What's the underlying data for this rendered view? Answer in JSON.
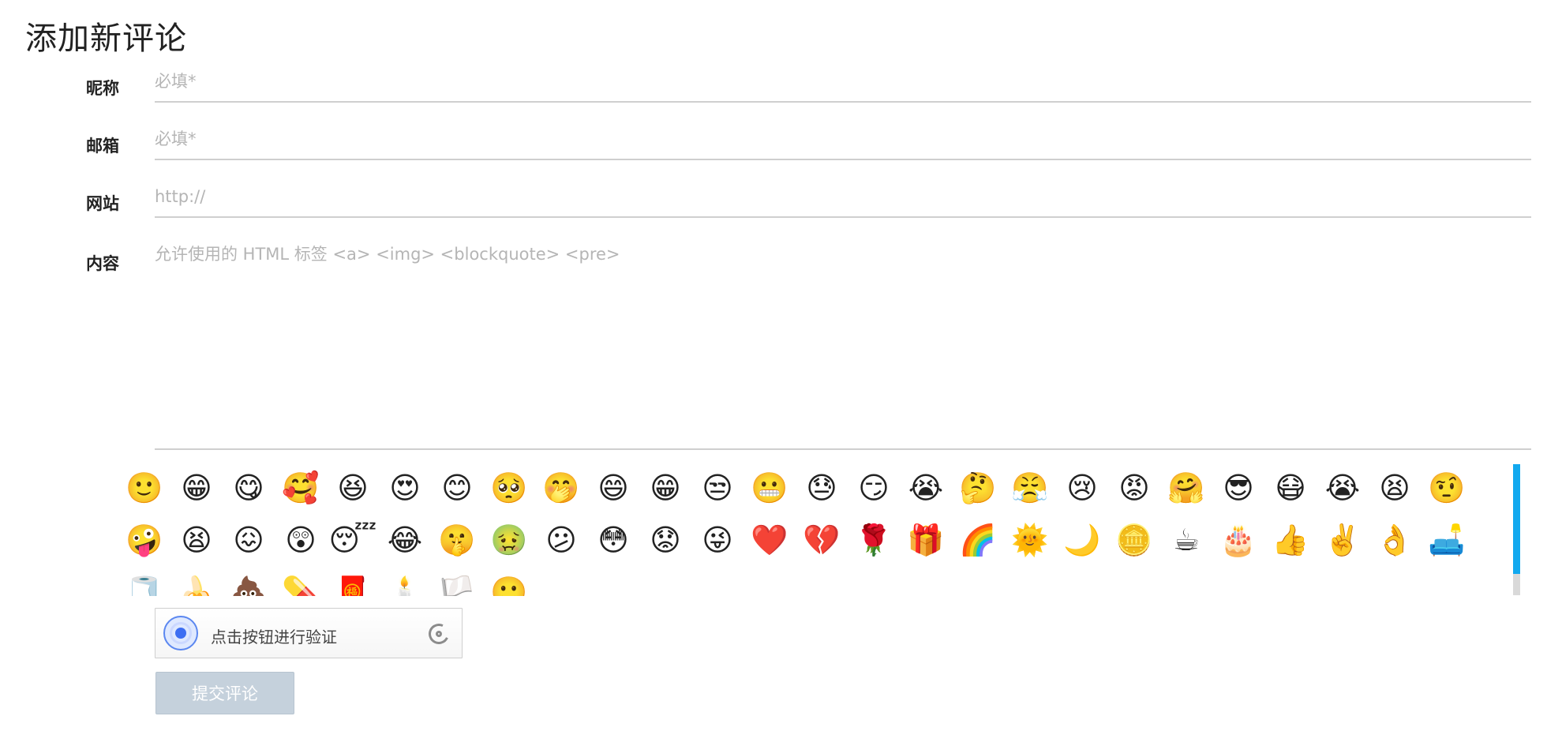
{
  "page": {
    "title": "添加新评论"
  },
  "form": {
    "fields": [
      {
        "label": "昵称",
        "placeholder": "必填*"
      },
      {
        "label": "邮箱",
        "placeholder": "必填*"
      },
      {
        "label": "网站",
        "placeholder": "http://"
      },
      {
        "label": "内容",
        "placeholder": "允许使用的 HTML 标签 <a> <img> <blockquote> <pre>"
      }
    ]
  },
  "emoji_panel": {
    "icons": [
      {
        "name": "smile-emoji-icon",
        "glyph": "🙂"
      },
      {
        "name": "grin-emoji-icon",
        "glyph": "😁"
      },
      {
        "name": "tongue-emoji-icon",
        "glyph": "😋"
      },
      {
        "name": "shy-emoji-icon",
        "glyph": "🥰"
      },
      {
        "name": "laugh-emoji-icon",
        "glyph": "😆"
      },
      {
        "name": "heart-eyes-emoji-icon",
        "glyph": "😍"
      },
      {
        "name": "blush-emoji-icon",
        "glyph": "😊"
      },
      {
        "name": "pleading-emoji-icon",
        "glyph": "🥺"
      },
      {
        "name": "giggle-emoji-icon",
        "glyph": "🤭"
      },
      {
        "name": "happy-emoji-icon",
        "glyph": "😄"
      },
      {
        "name": "beaming-emoji-icon",
        "glyph": "😁"
      },
      {
        "name": "unamused-emoji-icon",
        "glyph": "😒"
      },
      {
        "name": "grimace-emoji-icon",
        "glyph": "😬"
      },
      {
        "name": "sweat-emoji-icon",
        "glyph": "😓"
      },
      {
        "name": "smirk-emoji-icon",
        "glyph": "😏"
      },
      {
        "name": "crying-emoji-icon",
        "glyph": "😭"
      },
      {
        "name": "thinking-emoji-icon",
        "glyph": "🤔"
      },
      {
        "name": "annoyed-emoji-icon",
        "glyph": "😤"
      },
      {
        "name": "tears-emoji-icon",
        "glyph": "😢"
      },
      {
        "name": "angry-emoji-icon",
        "glyph": "😡"
      },
      {
        "name": "hug-emoji-icon",
        "glyph": "🤗"
      },
      {
        "name": "sunglasses-emoji-icon",
        "glyph": "😎"
      },
      {
        "name": "mask-emoji-icon",
        "glyph": "😷"
      },
      {
        "name": "sob-emoji-icon",
        "glyph": "😭"
      },
      {
        "name": "shout-emoji-icon",
        "glyph": "😫"
      },
      {
        "name": "confused-emoji-icon",
        "glyph": "🤨"
      },
      {
        "name": "dizzy-emoji-icon",
        "glyph": "🤪"
      },
      {
        "name": "yawn-emoji-icon",
        "glyph": "😫"
      },
      {
        "name": "pout-emoji-icon",
        "glyph": "😖"
      },
      {
        "name": "surprised-emoji-icon",
        "glyph": "😲"
      },
      {
        "name": "sleepy-emoji-icon",
        "glyph": "😴"
      },
      {
        "name": "joy-emoji-icon",
        "glyph": "😂"
      },
      {
        "name": "shush-emoji-icon",
        "glyph": "🤫"
      },
      {
        "name": "sick-emoji-icon",
        "glyph": "🤢"
      },
      {
        "name": "meh-emoji-icon",
        "glyph": "😕"
      },
      {
        "name": "flushed-emoji-icon",
        "glyph": "😳"
      },
      {
        "name": "worried-emoji-icon",
        "glyph": "😟"
      },
      {
        "name": "wink-emoji-icon",
        "glyph": "😜"
      },
      {
        "name": "heart-icon",
        "glyph": "❤️"
      },
      {
        "name": "broken-heart-icon",
        "glyph": "💔"
      },
      {
        "name": "rose-icon",
        "glyph": "🌹"
      },
      {
        "name": "gift-icon",
        "glyph": "🎁"
      },
      {
        "name": "rainbow-icon",
        "glyph": "🌈"
      },
      {
        "name": "sun-icon",
        "glyph": "🌞"
      },
      {
        "name": "moon-icon",
        "glyph": "🌙"
      },
      {
        "name": "coin-icon",
        "glyph": "🪙"
      },
      {
        "name": "coffee-icon",
        "glyph": "☕"
      },
      {
        "name": "cake-icon",
        "glyph": "🎂"
      },
      {
        "name": "thumbs-up-icon",
        "glyph": "👍"
      },
      {
        "name": "victory-hand-icon",
        "glyph": "✌️"
      },
      {
        "name": "ok-hand-icon",
        "glyph": "👌"
      },
      {
        "name": "sofa-icon",
        "glyph": "🛋️"
      },
      {
        "name": "toilet-paper-icon",
        "glyph": "🧻"
      },
      {
        "name": "banana-icon",
        "glyph": "🍌"
      },
      {
        "name": "poop-icon",
        "glyph": "💩"
      },
      {
        "name": "pill-icon",
        "glyph": "💊"
      },
      {
        "name": "red-envelope-icon",
        "glyph": "🧧"
      },
      {
        "name": "candle-icon",
        "glyph": "🕯️"
      },
      {
        "name": "flag-icon",
        "glyph": "🏳️"
      },
      {
        "name": "smile-small-emoji-icon",
        "glyph": "🙂"
      }
    ]
  },
  "captcha": {
    "text": "点击按钮进行验证"
  },
  "actions": {
    "submit_label": "提交评论"
  },
  "colors": {
    "scroll_thumb": "#12a9ef",
    "submit_bg": "#c5d1dc",
    "divider": "#cfcfcf",
    "placeholder": "#b5b5b5"
  },
  "icons": {
    "captcha_button": "shield-check-icon",
    "captcha_refresh": "refresh-icon"
  }
}
